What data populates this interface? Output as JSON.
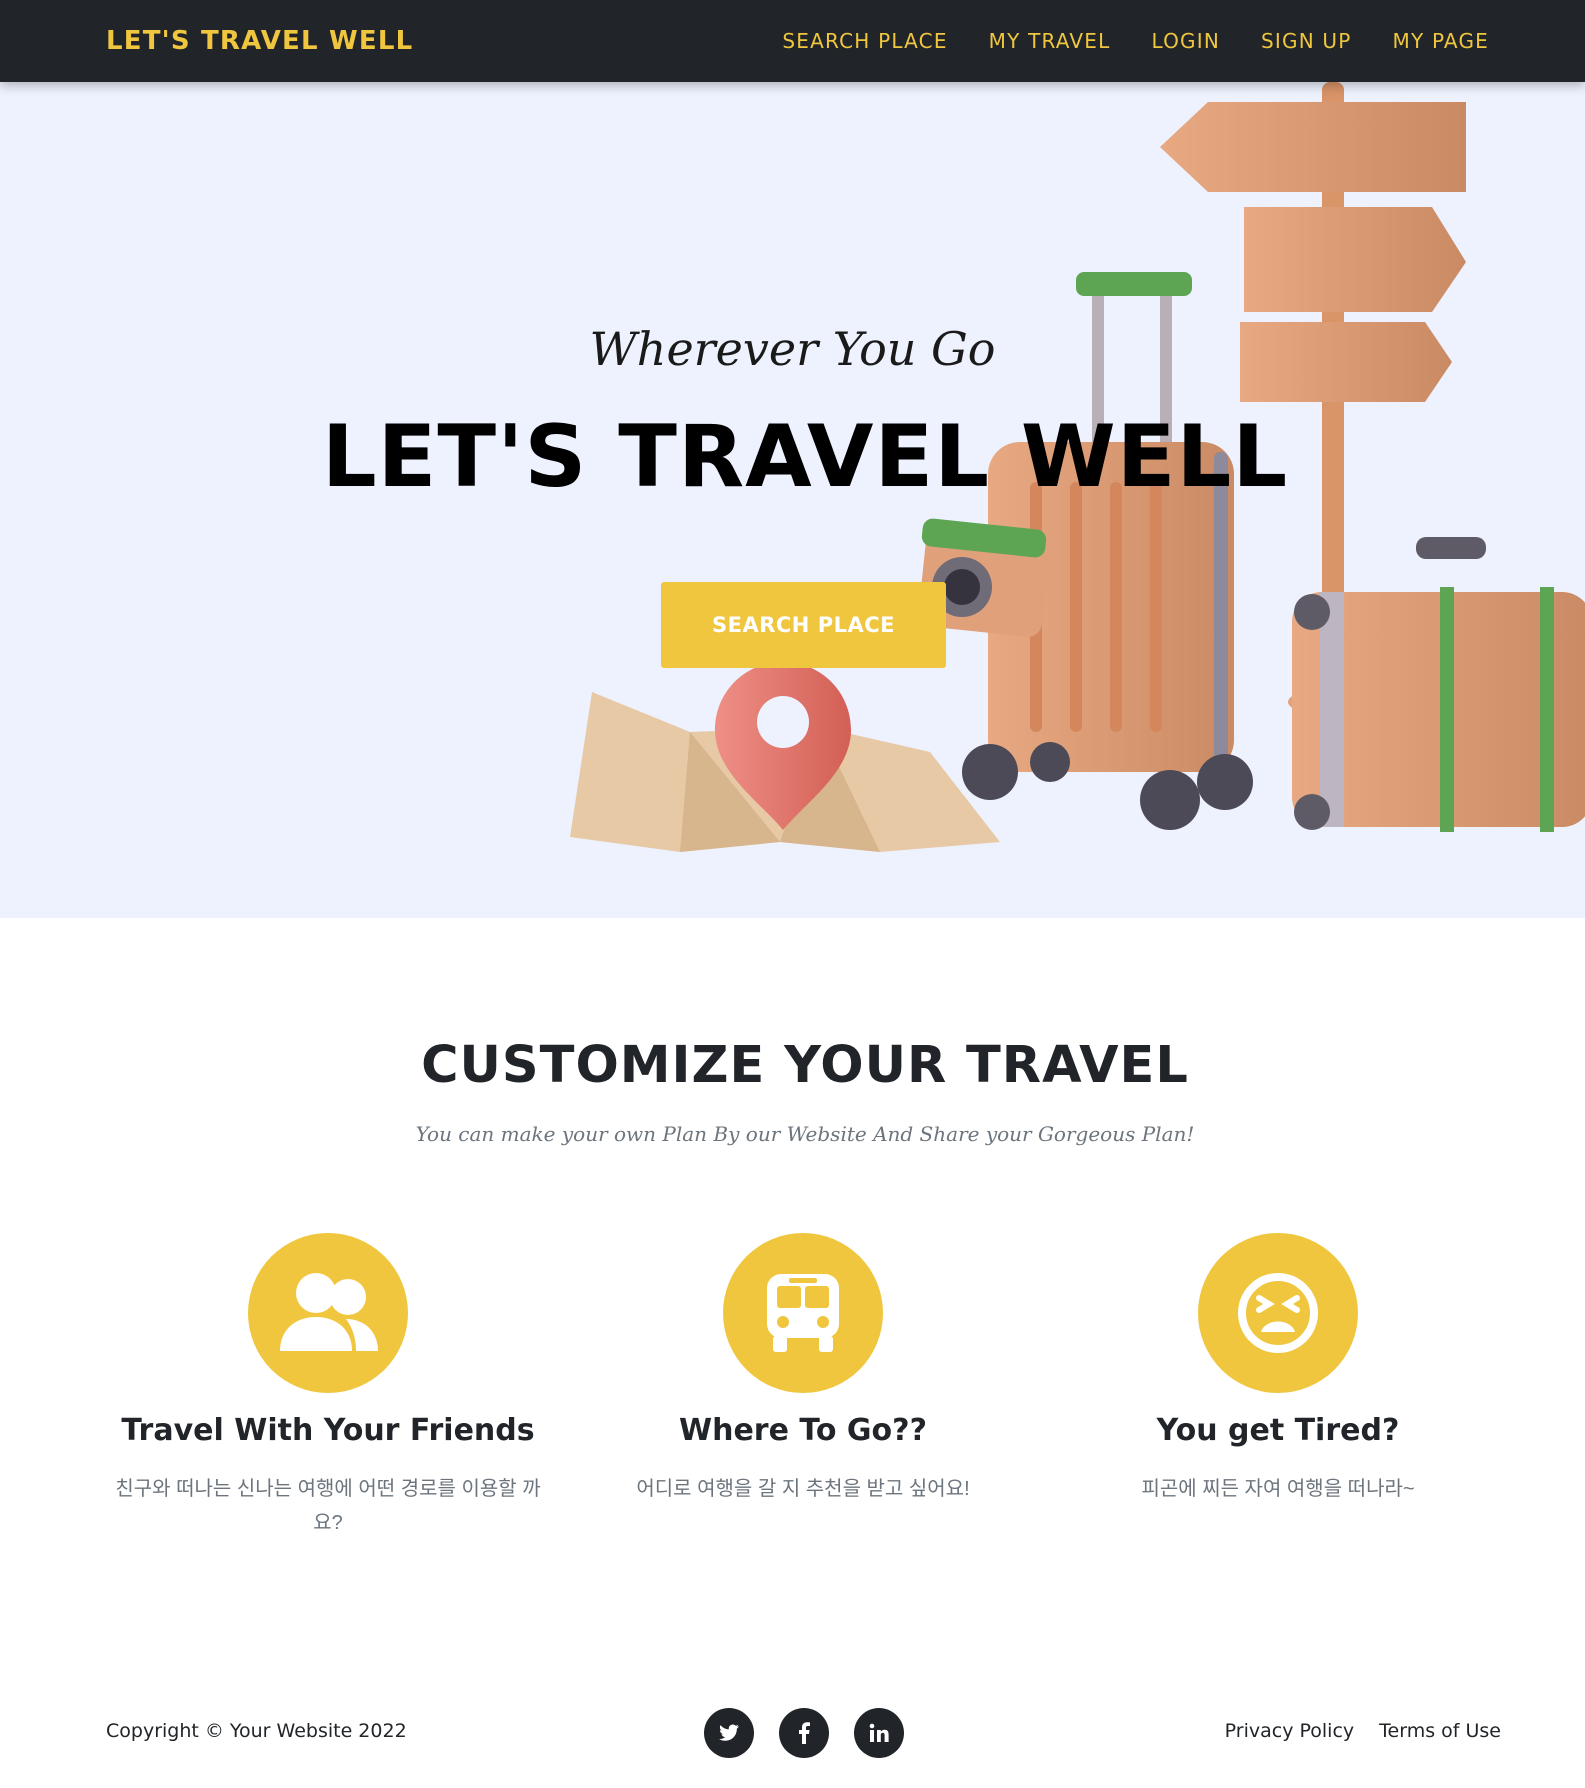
{
  "nav": {
    "brand": "LET'S TRAVEL WELL",
    "links": [
      "SEARCH PLACE",
      "MY TRAVEL",
      "LOGIN",
      "SIGN UP",
      "MY PAGE"
    ]
  },
  "hero": {
    "subheading": "Wherever You Go",
    "heading": "LET'S TRAVEL WELL",
    "button_label": "SEARCH PLACE"
  },
  "services": {
    "title": "CUSTOMIZE YOUR TRAVEL",
    "subtitle": "You can make your own Plan By our Website And Share your Gorgeous Plan!",
    "items": [
      {
        "icon": "users-icon",
        "title": "Travel With Your Friends",
        "text": "친구와 떠나는 신나는 여행에 어떤 경로를 이용할 까요?"
      },
      {
        "icon": "bus-icon",
        "title": "Where To Go??",
        "text": "어디로 여행을 갈 지 추천을 받고 싶어요!"
      },
      {
        "icon": "tired-face-icon",
        "title": "You get Tired?",
        "text": "피곤에 찌든 자여 여행을 떠나라~"
      }
    ]
  },
  "footer": {
    "copyright": "Copyright © Your Website 2022",
    "socials": [
      "twitter-icon",
      "facebook-icon",
      "linkedin-icon"
    ],
    "links": [
      "Privacy Policy",
      "Terms of Use"
    ]
  },
  "colors": {
    "accent": "#f0c63f",
    "dark": "#212529",
    "hero_bg": "#edf2fe"
  }
}
